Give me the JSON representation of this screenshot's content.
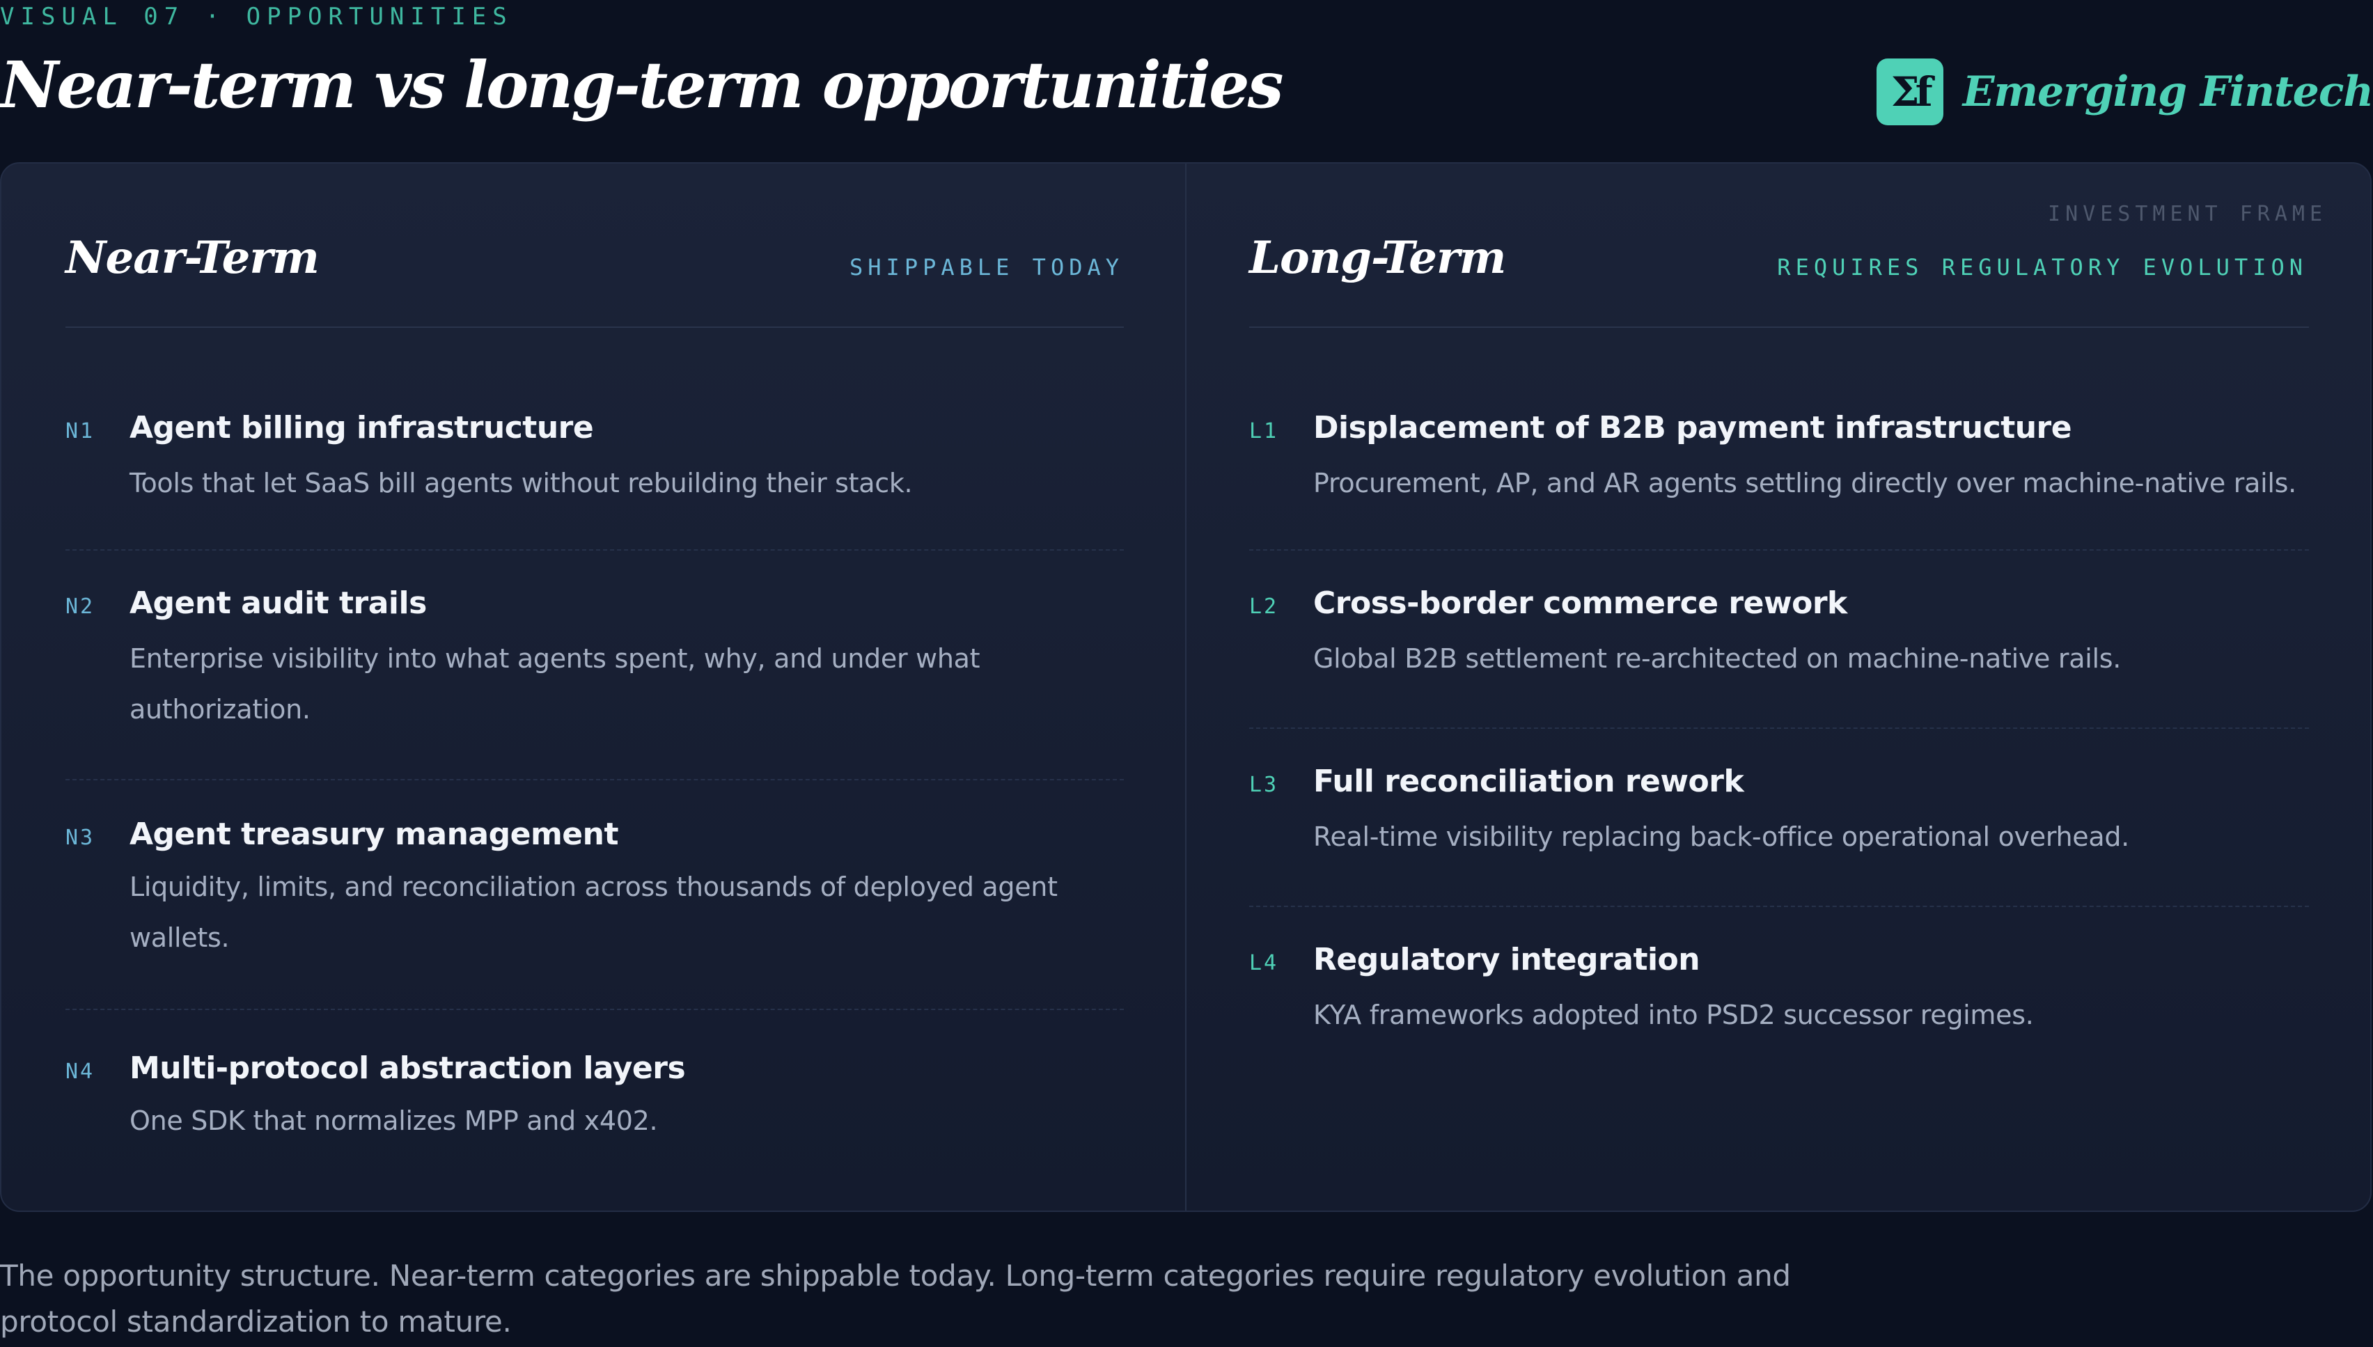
{
  "header": {
    "eyebrow": "VISUAL 07 · OPPORTUNITIES",
    "title": "Near-term vs long-term opportunities",
    "brand": {
      "logo_text": "Σf",
      "name": "Emerging Fintech",
      "color": "#4fd1b6"
    }
  },
  "panel": {
    "frame_label": "INVESTMENT FRAME",
    "near_term": {
      "title": "Near-Term",
      "tag": "SHIPPABLE TODAY",
      "accent": "#6cb7d8",
      "items": [
        {
          "num": "N1",
          "title": "Agent billing infrastructure",
          "desc": "Tools that let SaaS bill agents without rebuilding their stack."
        },
        {
          "num": "N2",
          "title": "Agent audit trails",
          "desc": "Enterprise visibility into what agents spent, why, and under what authorization."
        },
        {
          "num": "N3",
          "title": "Agent treasury management",
          "desc": "Liquidity, limits, and reconciliation across thousands of deployed agent wallets."
        },
        {
          "num": "N4",
          "title": "Multi-protocol abstraction layers",
          "desc": "One SDK that normalizes MPP and x402."
        }
      ]
    },
    "long_term": {
      "title": "Long-Term",
      "tag": "REQUIRES REGULATORY EVOLUTION",
      "accent": "#4fd1b6",
      "items": [
        {
          "num": "L1",
          "title": "Displacement of B2B payment infrastructure",
          "desc": "Procurement, AP, and AR agents settling directly over machine-native rails."
        },
        {
          "num": "L2",
          "title": "Cross-border commerce rework",
          "desc": "Global B2B settlement re-architected on machine-native rails."
        },
        {
          "num": "L3",
          "title": "Full reconciliation rework",
          "desc": "Real-time visibility replacing back-office operational overhead."
        },
        {
          "num": "L4",
          "title": "Regulatory integration",
          "desc": "KYA frameworks adopted into PSD2 successor regimes."
        }
      ]
    }
  },
  "caption": "The opportunity structure. Near-term categories are shippable today. Long-term categories require regulatory evolution and protocol standardization to mature."
}
